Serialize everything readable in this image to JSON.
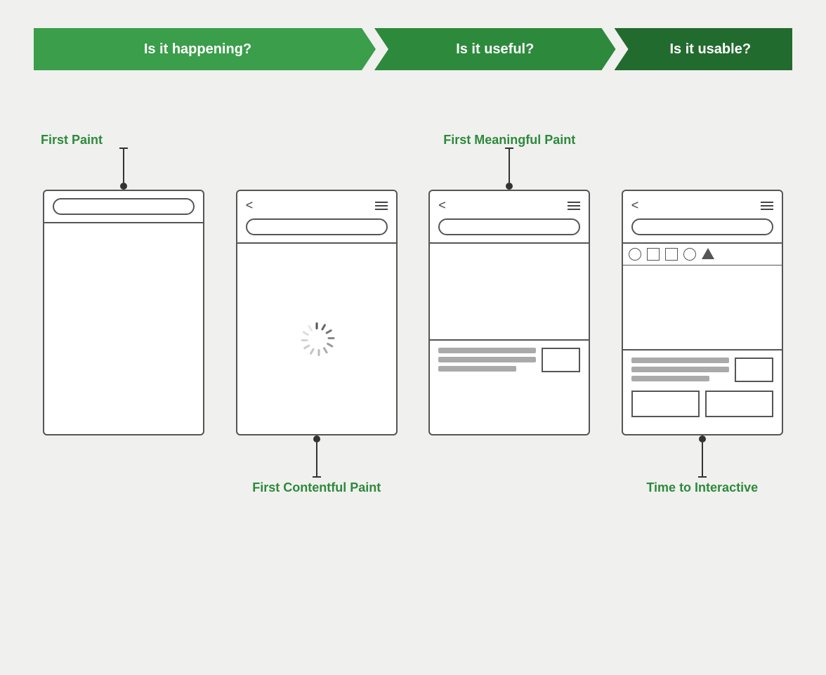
{
  "banner": {
    "segment1": "Is it happening?",
    "segment2": "Is it useful?",
    "segment3": "Is it usable?"
  },
  "metrics": {
    "first_paint": "First Paint",
    "first_contentful_paint": "First Contentful Paint",
    "first_meaningful_paint": "First Meaningful Paint",
    "time_to_interactive": "Time to Interactive"
  },
  "colors": {
    "green_light": "#3a9e4a",
    "green_mid": "#2d8a3c",
    "green_dark": "#226b2e",
    "label_green": "#2d8a3c"
  }
}
